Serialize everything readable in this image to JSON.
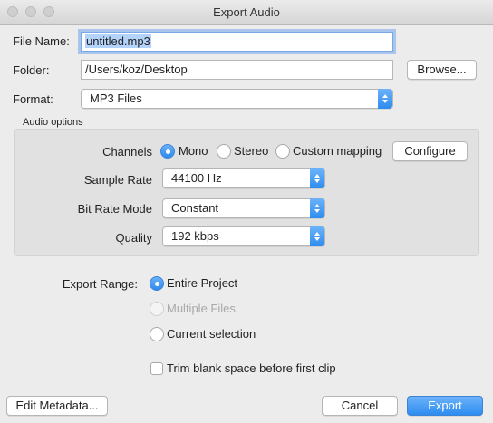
{
  "window": {
    "title": "Export Audio"
  },
  "file": {
    "name_label": "File Name:",
    "name_value": "untitled.mp3",
    "folder_label": "Folder:",
    "folder_value": "/Users/koz/Desktop",
    "browse_label": "Browse...",
    "format_label": "Format:",
    "format_value": "MP3 Files"
  },
  "audio_options": {
    "title": "Audio options",
    "channels_label": "Channels",
    "channels_options": [
      "Mono",
      "Stereo",
      "Custom mapping"
    ],
    "channels_selected": "Mono",
    "configure_label": "Configure",
    "sample_rate_label": "Sample Rate",
    "sample_rate_value": "44100 Hz",
    "bit_rate_mode_label": "Bit Rate Mode",
    "bit_rate_mode_value": "Constant",
    "quality_label": "Quality",
    "quality_value": "192 kbps"
  },
  "export_range": {
    "label": "Export Range:",
    "options": [
      "Entire Project",
      "Multiple Files",
      "Current selection"
    ],
    "selected": "Entire Project",
    "disabled": [
      "Multiple Files"
    ]
  },
  "trim": {
    "label": "Trim blank space before first clip",
    "checked": false
  },
  "footer": {
    "edit_metadata_label": "Edit Metadata...",
    "cancel_label": "Cancel",
    "export_label": "Export"
  },
  "colors": {
    "accent": "#2d8cf0",
    "selection": "#b3d3fb"
  }
}
